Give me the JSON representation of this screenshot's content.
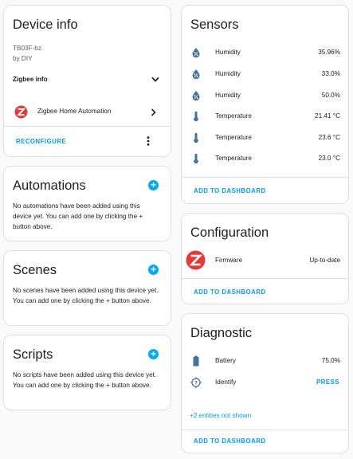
{
  "device_info": {
    "title": "Device info",
    "model": "TB03F-bz",
    "manufacturer": "by DIY",
    "zigbee_info_label": "Zigbee info",
    "integration_label": "Zigbee Home Automation",
    "reconfigure_label": "RECONFIGURE"
  },
  "automations": {
    "title": "Automations",
    "empty_text": "No automations have been added using this device yet. You can add one by clicking the + button above."
  },
  "scenes": {
    "title": "Scenes",
    "empty_text": "No scenes have been added using this device yet. You can add one by clicking the + button above."
  },
  "scripts": {
    "title": "Scripts",
    "empty_text": "No scripts have been added using this device yet. You can add one by clicking the + button above."
  },
  "sensors": {
    "title": "Sensors",
    "rows": [
      {
        "icon": "water-percent-icon",
        "label": "Humidity",
        "value": "35.96%"
      },
      {
        "icon": "water-percent-icon",
        "label": "Humidity",
        "value": "33.0%"
      },
      {
        "icon": "water-percent-icon",
        "label": "Humidity",
        "value": "50.0%"
      },
      {
        "icon": "thermometer-icon",
        "label": "Temperature",
        "value": "21.41 °C"
      },
      {
        "icon": "thermometer-icon",
        "label": "Temperature",
        "value": "23.6 °C"
      },
      {
        "icon": "thermometer-icon",
        "label": "Temperature",
        "value": "23.0 °C"
      }
    ],
    "add_label": "ADD TO DASHBOARD"
  },
  "configuration": {
    "title": "Configuration",
    "firmware_label": "Firmware",
    "firmware_value": "Up-to-date",
    "add_label": "ADD TO DASHBOARD"
  },
  "diagnostic": {
    "title": "Diagnostic",
    "battery_label": "Battery",
    "battery_value": "75.0%",
    "identify_label": "Identify",
    "identify_action": "PRESS",
    "hidden_entities": "+2 entities not shown",
    "add_label": "ADD TO DASHBOARD"
  },
  "colors": {
    "accent": "#03a9f4",
    "link": "#039be5",
    "icon": "#44739e",
    "zigbee_red": "#e53935"
  }
}
